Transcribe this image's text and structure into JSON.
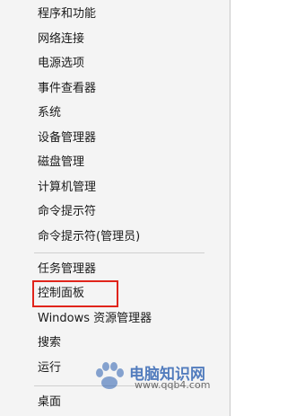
{
  "menu": {
    "items": [
      {
        "label": "程序和功能"
      },
      {
        "label": "网络连接"
      },
      {
        "label": "电源选项"
      },
      {
        "label": "事件查看器"
      },
      {
        "label": "系统"
      },
      {
        "label": "设备管理器"
      },
      {
        "label": "磁盘管理"
      },
      {
        "label": "计算机管理"
      },
      {
        "label": "命令提示符"
      },
      {
        "label": "命令提示符(管理员)"
      },
      {
        "label": "任务管理器"
      },
      {
        "label": "控制面板"
      },
      {
        "label": "Windows 资源管理器"
      },
      {
        "label": "搜索"
      },
      {
        "label": "运行"
      },
      {
        "label": "桌面"
      }
    ]
  },
  "watermark": {
    "text": "电脑知识网",
    "url": "www.qqb4.com"
  },
  "colors": {
    "highlight_border": "#e0241b",
    "menu_background": "#f4f4f4"
  }
}
